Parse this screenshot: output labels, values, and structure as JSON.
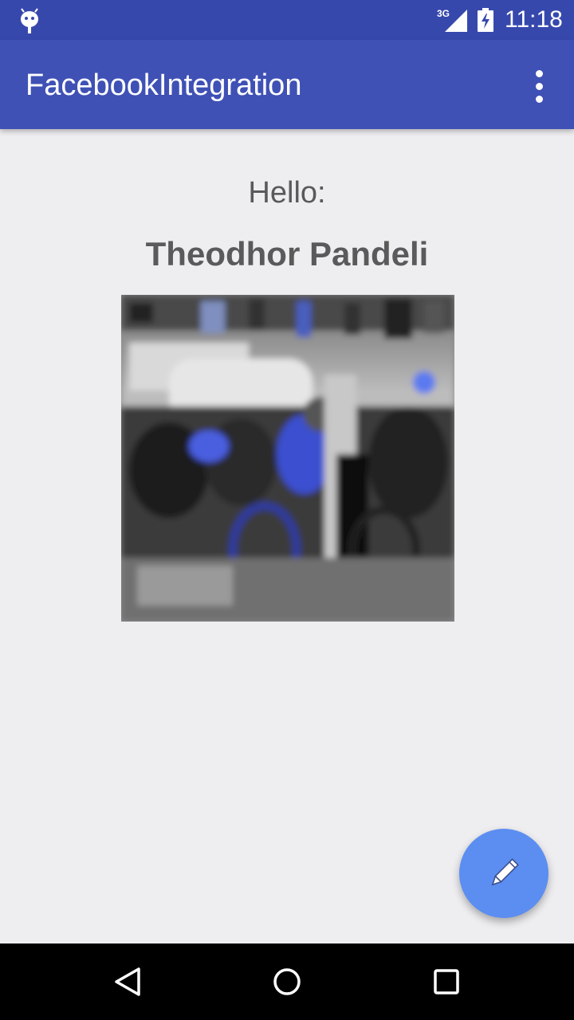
{
  "status_bar": {
    "time": "11:18",
    "network": "3G",
    "icons": [
      "android-debug-icon",
      "signal-3g-icon",
      "battery-charging-icon"
    ]
  },
  "app_bar": {
    "title": "FacebookIntegration",
    "overflow_icon": "more-vert-icon"
  },
  "main": {
    "greeting": "Hello:",
    "user_name": "Theodhor Pandeli",
    "profile_photo_icon": "profile-picture"
  },
  "fab": {
    "icon": "pencil-icon"
  },
  "nav_bar": {
    "icons": [
      "back-icon",
      "home-icon",
      "recents-icon"
    ]
  },
  "colors": {
    "status_bar": "#3748ad",
    "app_bar": "#3f51b5",
    "background": "#eeedf0",
    "fab": "#5b8ef0",
    "text": "#595959"
  }
}
